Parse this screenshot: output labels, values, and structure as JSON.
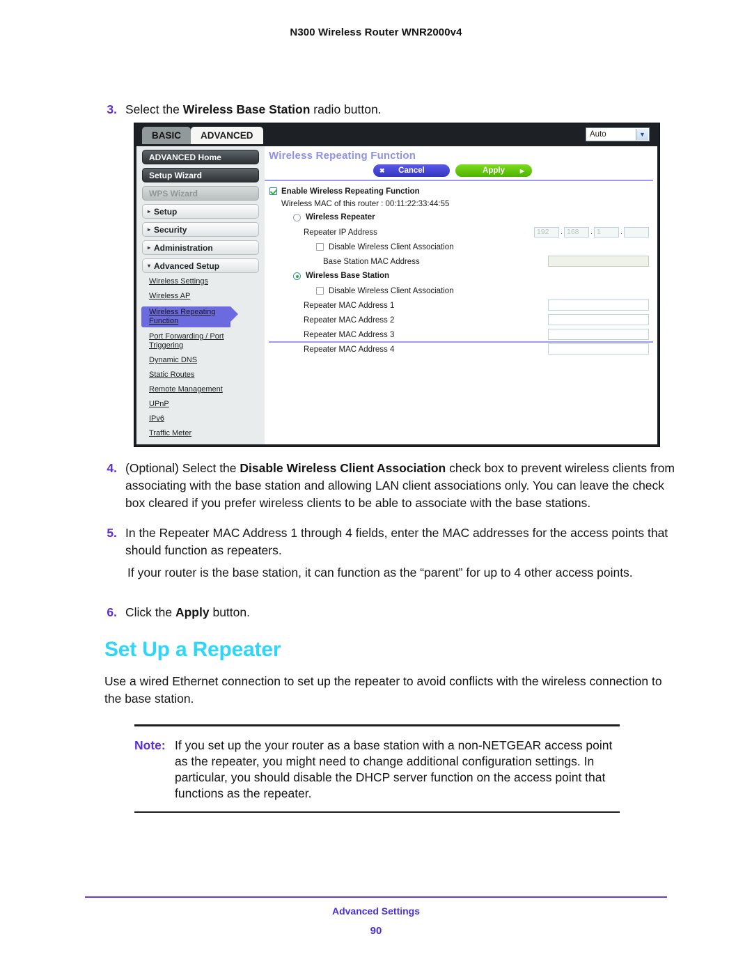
{
  "header": {
    "title": "N300 Wireless Router WNR2000v4"
  },
  "steps": {
    "s3": {
      "num": "3.",
      "pre": "Select the ",
      "bold": "Wireless Base Station",
      "post": " radio button."
    },
    "s4": {
      "num": "4.",
      "pre": "(Optional) Select the ",
      "bold": "Disable Wireless Client Association",
      "post": " check box to prevent wireless clients from associating with the base station and allowing LAN client associations only. You can leave the check box cleared if you prefer wireless clients to be able to associate with the base stations."
    },
    "s5": {
      "num": "5.",
      "pre": "In the Repeater MAC Address 1 through 4 fields, enter the MAC addresses for the access points that should function as repeaters.",
      "bold": "",
      "post": ""
    },
    "s6": {
      "num": "6.",
      "pre": "Click the ",
      "bold": "Apply",
      "post": " button."
    }
  },
  "paragraphs": {
    "parent_note": "If your router is the base station, it can function as the “parent” for up to 4 other access points.",
    "intro": "Use a wired Ethernet connection to set up the repeater to avoid conflicts with the wireless connection to the base station."
  },
  "section_heading": "Set Up a Repeater",
  "note": {
    "label": "Note:",
    "text": "If you set up the your router as a base station with a non-NETGEAR access point as the repeater, you might need to change additional configuration settings. In particular, you should disable the DHCP server function on the access point that functions as the repeater."
  },
  "footer": {
    "section": "Advanced Settings",
    "page": "90"
  },
  "screenshot": {
    "tabs": [
      {
        "label": "BASIC",
        "active": false
      },
      {
        "label": "ADVANCED",
        "active": true
      }
    ],
    "language_select": {
      "value": "Auto",
      "caret": "chevron-down-icon"
    },
    "nav_buttons": [
      {
        "label": "ADVANCED Home",
        "disabled": false
      },
      {
        "label": "Setup Wizard",
        "disabled": false
      },
      {
        "label": "WPS Wizard",
        "disabled": true
      }
    ],
    "nav_categories": [
      {
        "label": "Setup",
        "arrow": "▸"
      },
      {
        "label": "Security",
        "arrow": "▸"
      },
      {
        "label": "Administration",
        "arrow": "▸"
      },
      {
        "label": "Advanced Setup",
        "arrow": "▾"
      }
    ],
    "nav_links": [
      {
        "label": "Wireless Settings",
        "selected": false
      },
      {
        "label": "Wireless AP",
        "selected": false
      },
      {
        "label": "Wireless Repeating Function",
        "selected": true
      },
      {
        "label": "Port Forwarding / Port Triggering",
        "selected": false
      },
      {
        "label": "Dynamic DNS",
        "selected": false
      },
      {
        "label": "Static Routes",
        "selected": false
      },
      {
        "label": "Remote Management",
        "selected": false
      },
      {
        "label": "UPnP",
        "selected": false
      },
      {
        "label": "IPv6",
        "selected": false
      },
      {
        "label": "Traffic Meter",
        "selected": false
      }
    ],
    "pane_title": "Wireless Repeating Function",
    "buttons": {
      "cancel": {
        "label": "Cancel",
        "glyph": "✖"
      },
      "apply": {
        "label": "Apply",
        "glyph": "▶"
      }
    },
    "form": {
      "enable_label": "Enable Wireless Repeating Function",
      "enable_checked": true,
      "mac_line": "Wireless MAC of this router : 00:11:22:33:44:55",
      "repeater_radio": {
        "label": "Wireless Repeater",
        "selected": false
      },
      "repeater_ip_label": "Repeater IP Address",
      "repeater_ip": {
        "o1": "192",
        "o2": "168",
        "o3": "1",
        "o4": ""
      },
      "disable_assoc_1": {
        "label": "Disable Wireless Client Association",
        "checked": false
      },
      "base_station_mac_label": "Base Station MAC Address",
      "base_station_mac_value": "",
      "base_radio": {
        "label": "Wireless Base Station",
        "selected": true
      },
      "disable_assoc_2": {
        "label": "Disable Wireless Client Association",
        "checked": false
      },
      "repeater_macs": [
        {
          "label": "Repeater MAC Address 1",
          "value": ""
        },
        {
          "label": "Repeater MAC Address 2",
          "value": ""
        },
        {
          "label": "Repeater MAC Address 3",
          "value": ""
        },
        {
          "label": "Repeater MAC Address 4",
          "value": ""
        }
      ]
    }
  }
}
